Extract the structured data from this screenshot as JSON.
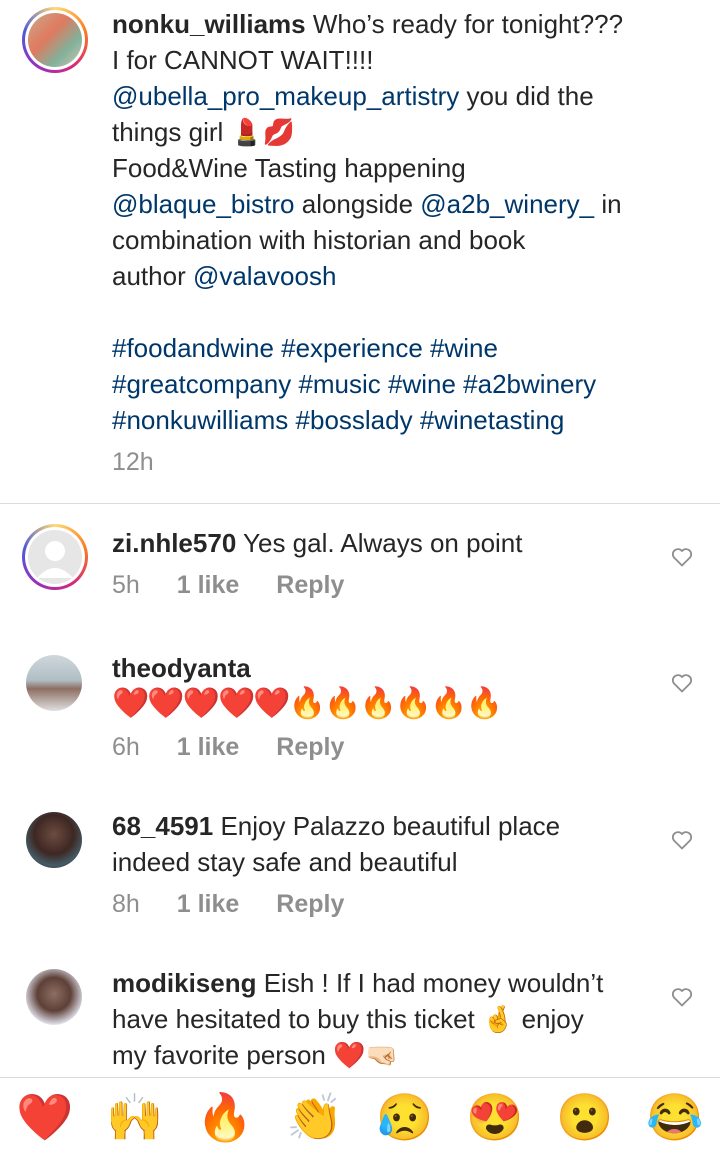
{
  "caption": {
    "username": "nonku_williams",
    "line1": " Who’s ready for tonight???",
    "line2": "I for CANNOT WAIT!!!!",
    "mention1": "@ubella_pro_makeup_artistry",
    "line3": " you did the",
    "line4": "things girl",
    "line4_emoji": "💄💋",
    "line5": "Food&Wine Tasting happening",
    "mention2": "@blaque_bistro",
    "line6": " alongside ",
    "mention3": "@a2b_winery_",
    "line6b": " in",
    "line7": "combination with historian and book",
    "line8": "author ",
    "mention4": "@valavoosh",
    "hashtags1": "#foodandwine #experience #wine",
    "hashtags2": "#greatcompany #music #wine #a2bwinery",
    "hashtags3": "#nonkuwilliams #bosslady #winetasting",
    "time": "12h"
  },
  "comments": [
    {
      "username": "zi.nhle570",
      "text": " Yes gal. Always on point",
      "time": "5h",
      "likes": "1 like",
      "reply": "Reply"
    },
    {
      "username": "theodyanta",
      "text": "❤️❤️❤️❤️❤️🔥🔥🔥🔥🔥🔥",
      "time": "6h",
      "likes": "1 like",
      "reply": "Reply"
    },
    {
      "username": "68_4591",
      "text": " Enjoy Palazzo beautiful place",
      "text2": "indeed stay safe and beautiful",
      "time": "8h",
      "likes": "1 like",
      "reply": "Reply"
    },
    {
      "username": "modikiseng",
      "text": " Eish ! If I had money wouldn’t",
      "text2": "have hesitated to buy this ticket ",
      "emoji2": "🤞",
      "text2b": " enjoy",
      "text3": "my favorite person ",
      "emoji3": "❤️🤜🏻"
    }
  ],
  "reactions": [
    "❤️",
    "🙌",
    "🔥",
    "👏",
    "😥",
    "😍",
    "😮",
    "😂"
  ],
  "colors": {
    "link": "#00376b",
    "meta": "#8e8e8e",
    "divider": "#dbdbdb"
  }
}
